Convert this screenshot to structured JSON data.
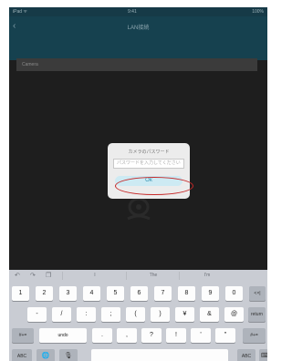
{
  "status": {
    "left": "iPad ᯤ",
    "time": "9:41",
    "right": "100%"
  },
  "nav": {
    "back_icon": "chevron-left-icon",
    "title": "LAN接続",
    "subtitle": ""
  },
  "panel": {
    "label": "Camera"
  },
  "dialog": {
    "title": "カメラのパスワード",
    "placeholder": "パスワードを入力してください",
    "ok_label": "Ok"
  },
  "keyboard": {
    "toolbar_icons": [
      "undo-icon",
      "redo-icon",
      "paste-icon"
    ],
    "suggestions": [
      "I",
      "The",
      "I'm"
    ],
    "row1": [
      "1",
      "2",
      "3",
      "4",
      "5",
      "6",
      "7",
      "8",
      "9",
      "0",
      "<×|"
    ],
    "row2": [
      "-",
      "/",
      ":",
      ";",
      "(",
      ")",
      "¥",
      "&",
      "@",
      "return"
    ],
    "row3": [
      "#+=",
      "undo",
      ".",
      ",",
      "?",
      "!",
      "'",
      "\"",
      "#+="
    ],
    "row4": [
      "ABC",
      "globe-icon",
      "microphone-icon",
      "",
      "ABC",
      "keyboard-icon"
    ],
    "labels": {
      "globe": "🌐",
      "mic": "🎙",
      "kb": "⌨"
    }
  }
}
